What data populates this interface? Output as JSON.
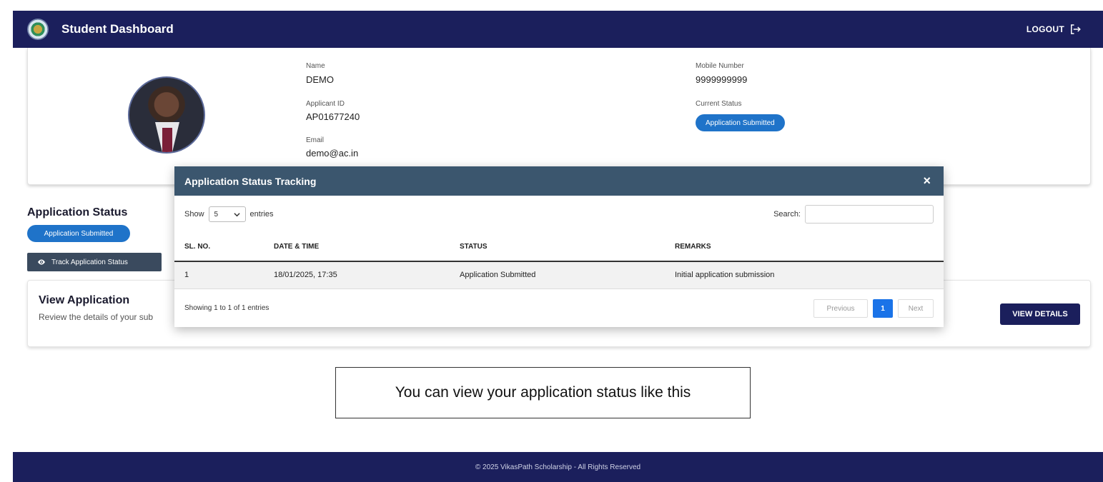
{
  "header": {
    "title": "Student Dashboard",
    "logout_label": "LOGOUT"
  },
  "profile": {
    "name_label": "Name",
    "name": "DEMO",
    "applicant_id_label": "Applicant ID",
    "applicant_id": "AP01677240",
    "email_label": "Email",
    "email": "demo@ac.in",
    "mobile_label": "Mobile Number",
    "mobile": "9999999999",
    "current_status_label": "Current Status",
    "current_status": "Application Submitted"
  },
  "application_status": {
    "title": "Application Status",
    "badge": "Application Submitted",
    "track_button": "Track Application Status"
  },
  "view_application": {
    "title": "View Application",
    "description": "Review the details of your sub",
    "button": "VIEW DETAILS"
  },
  "modal": {
    "title": "Application Status Tracking",
    "close": "×",
    "show_label": "Show",
    "entries_value": "5",
    "entries_label": "entries",
    "search_label": "Search:",
    "columns": [
      "SL. NO.",
      "DATE & TIME",
      "STATUS",
      "REMARKS"
    ],
    "rows": [
      [
        "1",
        "18/01/2025, 17:35",
        "Application Submitted",
        "Initial application submission"
      ]
    ],
    "showing": "Showing 1 to 1 of 1 entries",
    "pagination": {
      "previous": "Previous",
      "current": "1",
      "next": "Next"
    }
  },
  "caption": "You can view your application status like this",
  "footer": "© 2025 VikasPath Scholarship - All Rights Reserved",
  "colors": {
    "navy": "#1b1f5c",
    "modal_header": "#3b566e",
    "accent_blue": "#1f73c9"
  }
}
